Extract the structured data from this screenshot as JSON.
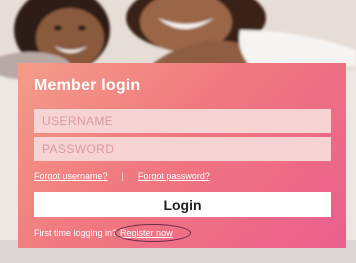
{
  "login": {
    "title": "Member login",
    "username_placeholder": "USERNAME",
    "password_placeholder": "PASSWORD",
    "forgot_username": "Forgot username?",
    "separator": "|",
    "forgot_password": "Forgot password?",
    "login_button": "Login",
    "first_time_text": "First time logging in?",
    "register_link": "Register now"
  },
  "colors": {
    "panel_gradient_start": "#f49c88",
    "panel_gradient_mid": "#f0787f",
    "panel_gradient_end": "#ea5f8e",
    "field_background": "#f7d3d3",
    "register_circle": "#6b2b4a"
  }
}
